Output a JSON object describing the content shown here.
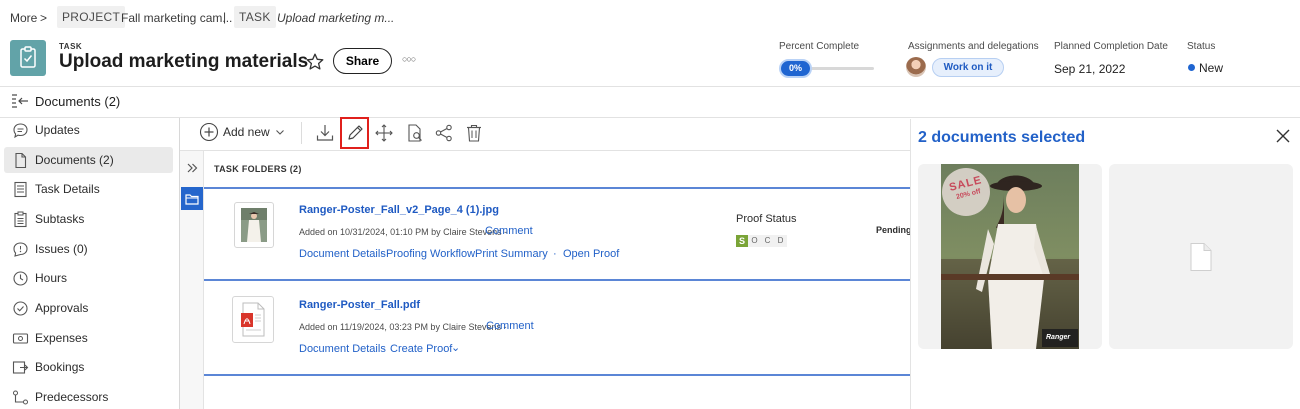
{
  "breadcrumb": {
    "more": "More",
    "sep": ">",
    "project_tag": "PROJECT",
    "project_name": "Fall marketing cam...",
    "pipe": "|",
    "task_tag": "TASK",
    "task_name": "Upload marketing m..."
  },
  "header": {
    "object_type": "TASK",
    "title": "Upload marketing materials",
    "share_label": "Share",
    "more_label": "○○○",
    "percent_complete_label": "Percent Complete",
    "percent_complete_value": "0%",
    "percent_fraction": 0,
    "assignments_label": "Assignments and delegations",
    "work_on_it_label": "Work on it",
    "planned_completion_label": "Planned Completion Date",
    "planned_completion_value": "Sep 21, 2022",
    "status_label": "Status",
    "status_value": "New",
    "status_color": "#1f65d1"
  },
  "section": {
    "title": "Documents (2)"
  },
  "sidebar": {
    "items": [
      {
        "label": "Updates",
        "icon": "chat-bubble-icon"
      },
      {
        "label": "Documents (2)",
        "icon": "document-icon",
        "active": true
      },
      {
        "label": "Task Details",
        "icon": "details-list-icon"
      },
      {
        "label": "Subtasks",
        "icon": "subtasks-icon"
      },
      {
        "label": "Issues (0)",
        "icon": "issue-bubble-icon"
      },
      {
        "label": "Hours",
        "icon": "clock-icon"
      },
      {
        "label": "Approvals",
        "icon": "check-circle-icon"
      },
      {
        "label": "Expenses",
        "icon": "expenses-icon"
      },
      {
        "label": "Bookings",
        "icon": "bookings-icon"
      },
      {
        "label": "Predecessors",
        "icon": "predecessors-icon"
      }
    ]
  },
  "toolbar": {
    "add_new_label": "Add new"
  },
  "folders": {
    "header": "TASK FOLDERS (2)"
  },
  "documents": [
    {
      "name": "Ranger-Poster_Fall_v2_Page_4 (1).jpg",
      "added": "Added on 10/31/2024, 01:10 PM by Claire Stevens -",
      "comment": "Comment",
      "actions": [
        "Document Details",
        "Proofing Workflow",
        "Print Summary",
        "Open Proof"
      ],
      "sep": "·",
      "proof_status_label": "Proof Status",
      "proof_letters": [
        "S",
        "O",
        "C",
        "D"
      ],
      "pending": "Pending"
    },
    {
      "name": "Ranger-Poster_Fall.pdf",
      "added": "Added on 11/19/2024, 03:23 PM by Claire Stevens -",
      "comment": "Comment",
      "actions": [
        "Document Details",
        "Create Proof"
      ],
      "sep": "·",
      "chevron": "⌄"
    }
  ],
  "selection_panel": {
    "title": "2 documents selected",
    "poster_sale": "SALE",
    "poster_sale_sub": "20% off",
    "poster_brand": "Ranger"
  },
  "colors": {
    "accent": "#2261c8",
    "task_icon": "#62a3a8",
    "highlight": "#e0201c",
    "proof_s": "#7aa437"
  }
}
